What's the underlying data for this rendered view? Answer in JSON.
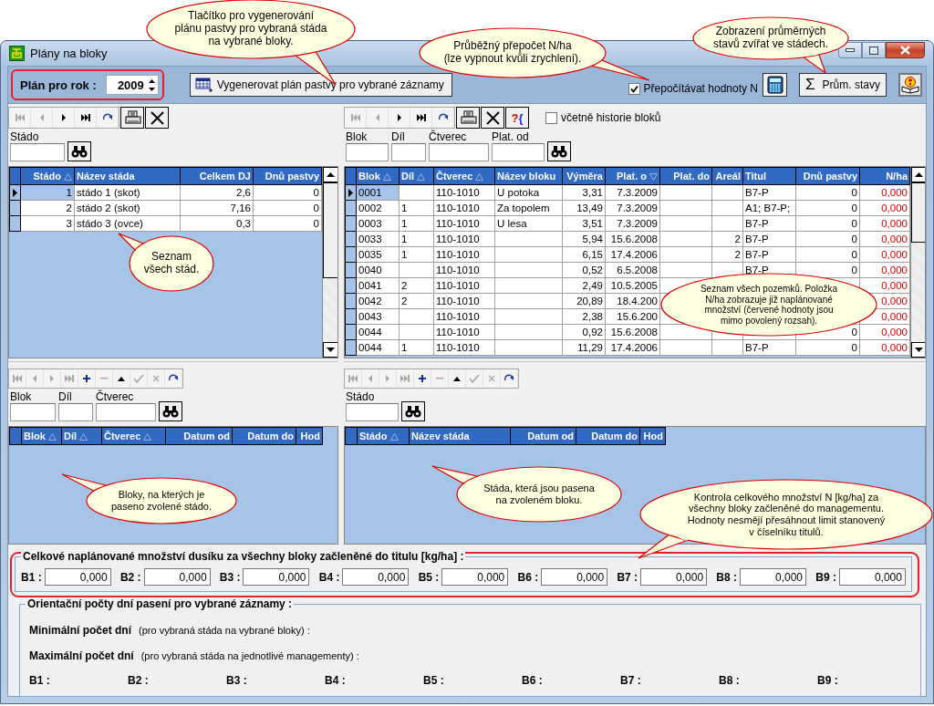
{
  "window": {
    "title": "Plány na bloky"
  },
  "header": {
    "year_label": "Plán pro rok :",
    "year": "2009",
    "generate_button": "Vygenerovat plán pastvy pro vybrané záznamy",
    "recalc": {
      "label": "Přepočítávat hodnoty N",
      "checked": true
    },
    "averages_button": {
      "glyph": "Σ",
      "label": "Prům. stavy"
    }
  },
  "herds": {
    "tools": [
      {
        "kind": "first",
        "disabled": true
      },
      {
        "kind": "prev",
        "disabled": true
      },
      {
        "kind": "next",
        "disabled": false
      },
      {
        "kind": "last",
        "disabled": false
      },
      {
        "kind": "refresh",
        "disabled": false
      },
      {
        "kind": "print",
        "disabled": false
      },
      {
        "kind": "delete",
        "disabled": false
      }
    ],
    "filters": [
      "Stádo"
    ],
    "table": {
      "columns": [
        {
          "label": "Stádo",
          "kind": "sort_up"
        },
        {
          "label": "Název stáda",
          "kind": "plain"
        },
        {
          "label": "Celkem DJ",
          "kind": "plain"
        },
        {
          "label": "Dnů pastvy",
          "kind": "plain"
        }
      ],
      "rows": [
        {
          "selected": true,
          "cells": [
            "1",
            "stádo 1 (skot)",
            "2,6",
            "0"
          ]
        },
        {
          "selected": false,
          "cells": [
            "2",
            "stádo 2 (skot)",
            "7,16",
            "0"
          ]
        },
        {
          "selected": false,
          "cells": [
            "3",
            "stádo 3 (ovce)",
            "0,3",
            "0"
          ]
        }
      ]
    }
  },
  "blocks": {
    "tools": [
      {
        "kind": "first",
        "disabled": true
      },
      {
        "kind": "prev",
        "disabled": true
      },
      {
        "kind": "next",
        "disabled": false
      },
      {
        "kind": "last",
        "disabled": false
      },
      {
        "kind": "refresh",
        "disabled": false
      },
      {
        "kind": "print",
        "disabled": false
      },
      {
        "kind": "delete",
        "disabled": false
      }
    ],
    "query_button": "?{",
    "history": {
      "label": "včetně historie bloků",
      "checked": false
    },
    "filters": [
      "Blok",
      "Díl",
      "Čtverec",
      "Plat. od"
    ],
    "table": {
      "columns": [
        {
          "label": "Blok",
          "kind": "sort_up"
        },
        {
          "label": "Díl",
          "kind": "sort_up"
        },
        {
          "label": "Čtverec",
          "kind": "sort_up"
        },
        {
          "label": "Název bloku",
          "kind": "plain"
        },
        {
          "label": "Výměra",
          "kind": "plain"
        },
        {
          "label": "Plat. o",
          "kind": "sort_down"
        },
        {
          "label": "Plat. do",
          "kind": "plain"
        },
        {
          "label": "Areál",
          "kind": "plain"
        },
        {
          "label": "Titul",
          "kind": "plain"
        },
        {
          "label": "Dnů pastvy",
          "kind": "plain"
        },
        {
          "label": "N/ha",
          "kind": "plain"
        }
      ],
      "rows": [
        {
          "selected": true,
          "out_of_range": true,
          "cells": [
            "0001",
            null,
            "110-1010",
            "U potoka",
            "3,31",
            "7.3.2009",
            null,
            null,
            "B7-P",
            "0",
            "0,000"
          ]
        },
        {
          "selected": false,
          "out_of_range": true,
          "cells": [
            "0002",
            "1",
            "110-1010",
            "Za topolem",
            "13,49",
            "7.3.2009",
            null,
            null,
            "A1; B7-P;",
            "0",
            "0,000"
          ]
        },
        {
          "selected": false,
          "out_of_range": true,
          "cells": [
            "0003",
            "1",
            "110-1010",
            "U lesa",
            "3,51",
            "7.3.2009",
            null,
            null,
            "B7-P",
            "0",
            "0,000"
          ]
        },
        {
          "selected": false,
          "out_of_range": true,
          "cells": [
            "0033",
            "1",
            "110-1010",
            null,
            "5,94",
            "15.6.2008",
            null,
            "2",
            "B7-P",
            "0",
            "0,000"
          ]
        },
        {
          "selected": false,
          "out_of_range": true,
          "cells": [
            "0035",
            "1",
            "110-1010",
            null,
            "6,15",
            "17.4.2006",
            null,
            "2",
            "B7-P",
            "0",
            "0,000"
          ]
        },
        {
          "selected": false,
          "out_of_range": true,
          "cells": [
            "0040",
            null,
            "110-1010",
            null,
            "0,52",
            "6.5.2008",
            null,
            null,
            "B7-P",
            "0",
            "0,000"
          ]
        },
        {
          "selected": false,
          "out_of_range": true,
          "cells": [
            "0041",
            "2",
            "110-1010",
            null,
            "2,49",
            "10.5.2005",
            null,
            null,
            null,
            null,
            "0,000"
          ]
        },
        {
          "selected": false,
          "out_of_range": true,
          "cells": [
            "0042",
            "2",
            "110-1010",
            null,
            "20,89",
            "18.4.200",
            null,
            null,
            null,
            null,
            "0,000"
          ]
        },
        {
          "selected": false,
          "out_of_range": true,
          "cells": [
            "0043",
            null,
            "110-1010",
            null,
            "2,38",
            "15.6.200",
            null,
            null,
            null,
            null,
            "0,000"
          ]
        },
        {
          "selected": false,
          "out_of_range": true,
          "cells": [
            "0044",
            null,
            "110-1010",
            null,
            "0,92",
            "15.6.2008",
            null,
            null,
            null,
            "0",
            "0,000"
          ]
        },
        {
          "selected": false,
          "out_of_range": true,
          "cells": [
            "0044",
            "1",
            "110-1010",
            null,
            "11,29",
            "17.4.2006",
            null,
            null,
            "B7-P",
            "0",
            "0,000"
          ]
        }
      ]
    }
  },
  "herd_blocks": {
    "tools": [
      {
        "kind": "first",
        "disabled": true
      },
      {
        "kind": "prev",
        "disabled": true
      },
      {
        "kind": "next",
        "disabled": true
      },
      {
        "kind": "last",
        "disabled": true
      },
      {
        "kind": "add",
        "disabled": false
      },
      {
        "kind": "remove",
        "disabled": true
      },
      {
        "kind": "up",
        "disabled": false
      },
      {
        "kind": "confirm",
        "disabled": true
      },
      {
        "kind": "cancel",
        "disabled": true
      },
      {
        "kind": "refresh",
        "disabled": false
      }
    ],
    "filters": [
      "Blok",
      "Díl",
      "Čtverec"
    ],
    "table": {
      "columns": [
        {
          "label": "Blok",
          "kind": "sort_up"
        },
        {
          "label": "Díl",
          "kind": "sort_up"
        },
        {
          "label": "Čtverec",
          "kind": "sort_up"
        },
        {
          "label": "Datum od",
          "kind": "plain"
        },
        {
          "label": "Datum do",
          "kind": "plain"
        },
        {
          "label": "Hod",
          "kind": "plain"
        }
      ]
    }
  },
  "block_herds": {
    "tools": [
      {
        "kind": "first",
        "disabled": true
      },
      {
        "kind": "prev",
        "disabled": true
      },
      {
        "kind": "next",
        "disabled": true
      },
      {
        "kind": "last",
        "disabled": true
      },
      {
        "kind": "add",
        "disabled": false
      },
      {
        "kind": "remove",
        "disabled": true
      },
      {
        "kind": "up",
        "disabled": false
      },
      {
        "kind": "confirm",
        "disabled": true
      },
      {
        "kind": "cancel",
        "disabled": true
      },
      {
        "kind": "refresh",
        "disabled": false
      }
    ],
    "filters": [
      "Stádo"
    ],
    "table": {
      "columns": [
        {
          "label": "Stádo",
          "kind": "sort_up"
        },
        {
          "label": "Název stáda",
          "kind": "plain"
        },
        {
          "label": "Datum od",
          "kind": "plain"
        },
        {
          "label": "Datum do",
          "kind": "plain"
        },
        {
          "label": "Hod",
          "kind": "plain"
        }
      ]
    }
  },
  "nitrogen_totals": {
    "title": "Celkové naplánované množství dusíku za všechny bloky začleněné do titulu [kg/ha] :",
    "fields": [
      {
        "label": "B1 :",
        "value": "0,000"
      },
      {
        "label": "B2 :",
        "value": "0,000"
      },
      {
        "label": "B3 :",
        "value": "0,000"
      },
      {
        "label": "B4 :",
        "value": "0,000"
      },
      {
        "label": "B5 :",
        "value": "0,000"
      },
      {
        "label": "B6 :",
        "value": "0,000"
      },
      {
        "label": "B7 :",
        "value": "0,000"
      },
      {
        "label": "B8 :",
        "value": "0,000"
      },
      {
        "label": "B9 :",
        "value": "0,000"
      }
    ]
  },
  "grazing_days": {
    "title": "Orientační počty dní pasení pro vybrané záznamy :",
    "rows": [
      {
        "label": "Minimální počet dní",
        "note": "(pro vybraná stáda na vybrané bloky) :"
      },
      {
        "label": "Maximální počet dní",
        "note": "(pro vybraná stáda na jednotlivé managementy) :"
      }
    ],
    "labels": [
      "B1 :",
      "B2 :",
      "B3 :",
      "B4 :",
      "B5 :",
      "B6 :",
      "B7 :",
      "B8 :",
      "B9 :"
    ]
  },
  "callouts": [
    {
      "text": "Tlačítko pro vygenerování\nplánu pastvy pro vybraná stáda\nna vybrané bloky."
    },
    {
      "text": "Průběžný přepočet N/ha\n(lze vypnout kvůli zrychlení)."
    },
    {
      "text": "Zobrazení průměrných\nstavů zvířat ve stádech."
    },
    {
      "text": "Seznam\nvšech stád."
    },
    {
      "text": "Seznam všech pozemků. Položka\nN/ha zobrazuje již naplánované\nmnožství (červené hodnoty jsou\nmimo povolený rozsah)."
    },
    {
      "text": "Bloky, na kterých je\npaseno zvolené stádo."
    },
    {
      "text": "Stáda, která jsou pasena\nna zvoleném bloku."
    },
    {
      "text": "Kontrola celkového množství N [kg/ha] za\nvšechny bloky začleněné do managementu.\nHodnoty nesmějí přesáhnout limit stanovený\nv číselníku titulů."
    }
  ]
}
